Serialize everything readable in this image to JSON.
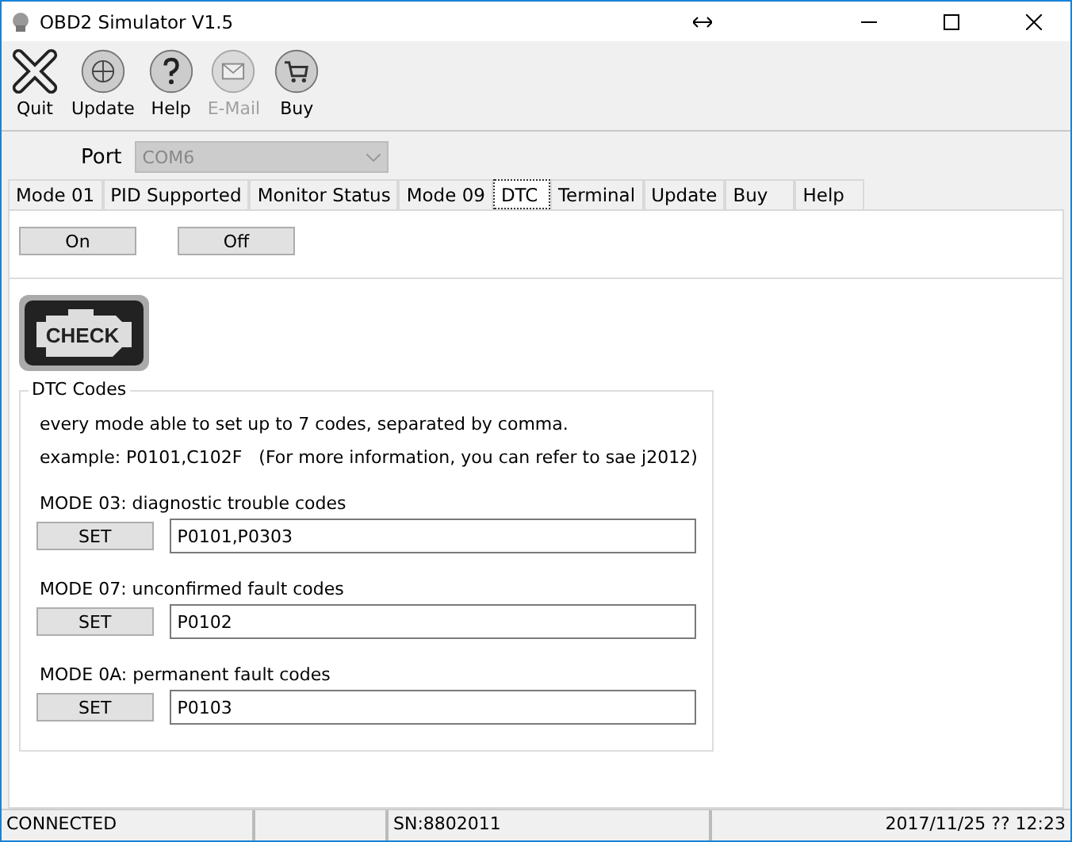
{
  "window": {
    "title": "OBD2 Simulator  V1.5"
  },
  "toolbar": [
    {
      "label": "Quit",
      "disabled": false
    },
    {
      "label": "Update",
      "disabled": false
    },
    {
      "label": "Help",
      "disabled": false
    },
    {
      "label": "E-Mail",
      "disabled": true
    },
    {
      "label": "Buy",
      "disabled": false
    }
  ],
  "port": {
    "label": "Port",
    "value": "COM6",
    "disabled": true
  },
  "tabs": [
    {
      "label": "Mode 01",
      "selected": false
    },
    {
      "label": "PID Supported",
      "selected": false
    },
    {
      "label": "Monitor Status",
      "selected": false
    },
    {
      "label": "Mode 09",
      "selected": false
    },
    {
      "label": "DTC",
      "selected": true
    },
    {
      "label": "Terminal",
      "selected": false
    },
    {
      "label": "Update",
      "selected": false
    },
    {
      "label": "Buy",
      "selected": false
    },
    {
      "label": "Help",
      "selected": false
    }
  ],
  "actions": [
    "On",
    "Off"
  ],
  "check_badge": "CHECK",
  "group": {
    "title": "DTC Codes",
    "notes": [
      "every mode able to set up to 7 codes, separated by comma.",
      "example: P0101,C102F   (For more information, you can refer to sae j2012)"
    ],
    "modes": [
      {
        "label": "MODE 03: diagnostic trouble codes",
        "button": "SET",
        "value": "P0101,P0303"
      },
      {
        "label": "MODE 07: unconfirmed fault codes",
        "button": "SET",
        "value": "P0102"
      },
      {
        "label": "MODE 0A: permanent fault codes",
        "button": "SET",
        "value": "P0103"
      }
    ]
  },
  "status_bar": {
    "connection": "CONNECTED",
    "serial": "SN:8802011",
    "datetime": "2017/11/25 ?? 12:23"
  }
}
